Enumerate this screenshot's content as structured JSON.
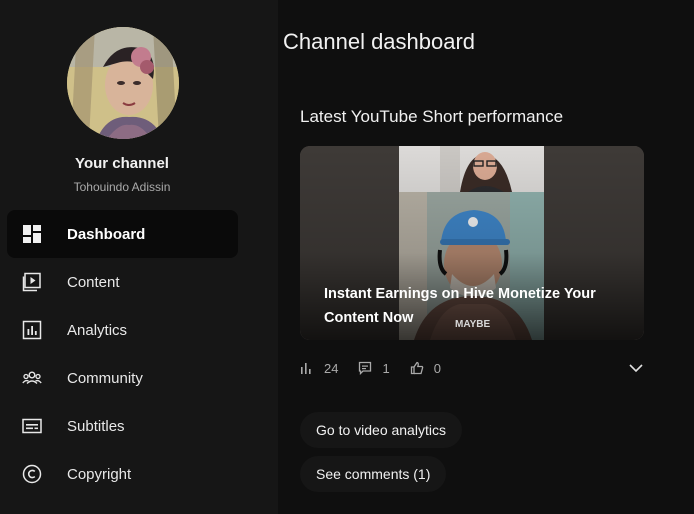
{
  "sidebar": {
    "channel_title": "Your channel",
    "channel_name": "Tohouindo Adissin",
    "items": [
      {
        "label": "Dashboard",
        "icon": "dashboard-icon",
        "active": true
      },
      {
        "label": "Content",
        "icon": "content-icon"
      },
      {
        "label": "Analytics",
        "icon": "analytics-icon"
      },
      {
        "label": "Community",
        "icon": "community-icon"
      },
      {
        "label": "Subtitles",
        "icon": "subtitles-icon"
      },
      {
        "label": "Copyright",
        "icon": "copyright-icon"
      }
    ]
  },
  "main": {
    "page_title": "Channel dashboard",
    "card": {
      "title": "Latest YouTube Short performance",
      "video_title": "Instant Earnings on Hive Monetize Your Content Now",
      "thumb_text": "MAYBE",
      "stats": {
        "views": "24",
        "comments": "1",
        "likes": "0"
      },
      "actions": {
        "analytics_label": "Go to video analytics",
        "comments_label": "See comments (1)"
      }
    }
  },
  "colors": {
    "background": "#0f0f0f",
    "sidebar": "#161616",
    "text": "#f1f1f1",
    "muted": "#aaaaaa"
  }
}
